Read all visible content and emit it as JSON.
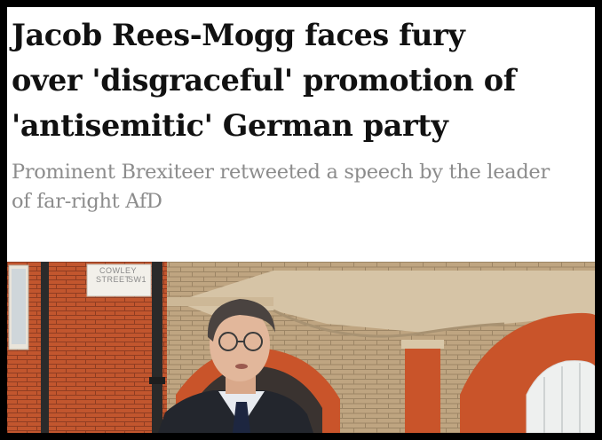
{
  "article": {
    "headline_lines": [
      "Jacob Rees-Mogg faces fury",
      "over 'disgraceful' promotion of",
      "'antisemitic' German party"
    ],
    "standfirst_lines": [
      "Prominent Brexiteer retweeted a speech by the leader",
      "of far-right AfD"
    ]
  },
  "photo": {
    "street_sign_lines": [
      "COWLEY",
      "STREET",
      "SW1"
    ]
  },
  "colors": {
    "frame": "#000000",
    "headline": "#111111",
    "standfirst": "#8c8c8c",
    "brick": "#c2562e",
    "stone": "#c9b79a"
  }
}
